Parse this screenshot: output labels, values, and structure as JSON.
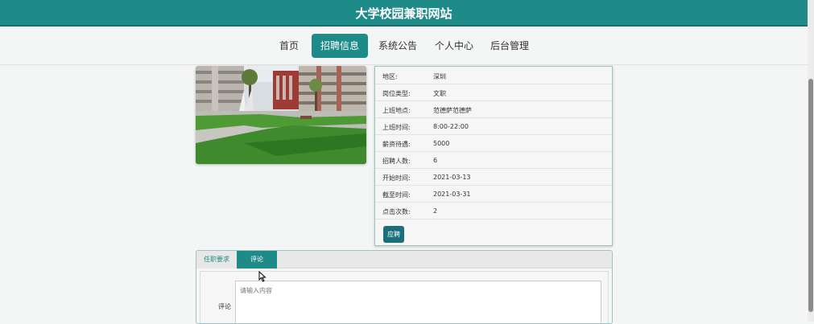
{
  "site": {
    "title": "大学校园兼职网站"
  },
  "nav": {
    "items": [
      {
        "label": "首页"
      },
      {
        "label": "招聘信息"
      },
      {
        "label": "系统公告"
      },
      {
        "label": "个人中心"
      },
      {
        "label": "后台管理"
      }
    ],
    "active_index": 1
  },
  "job": {
    "fields": [
      {
        "key": "地区:",
        "value": "深圳"
      },
      {
        "key": "岗位类型:",
        "value": "文职"
      },
      {
        "key": "上班地点:",
        "value": "范德萨范德萨"
      },
      {
        "key": "上班时间:",
        "value": "8:00-22:00"
      },
      {
        "key": "薪资待遇:",
        "value": "5000"
      },
      {
        "key": "招聘人数:",
        "value": "6"
      },
      {
        "key": "开始时间:",
        "value": "2021-03-13"
      },
      {
        "key": "截至时间:",
        "value": "2021-03-31"
      },
      {
        "key": "点击次数:",
        "value": "2"
      }
    ],
    "apply_label": "应聘"
  },
  "tabs": {
    "items": [
      {
        "label": "任职要求"
      },
      {
        "label": "评论"
      }
    ],
    "active_index": 1
  },
  "comment": {
    "label": "评论",
    "placeholder": "请输入内容"
  },
  "colors": {
    "accent": "#1f8b89",
    "apply_button": "#1a6f78"
  },
  "icons": {
    "cursor": "mouse-pointer-icon"
  }
}
